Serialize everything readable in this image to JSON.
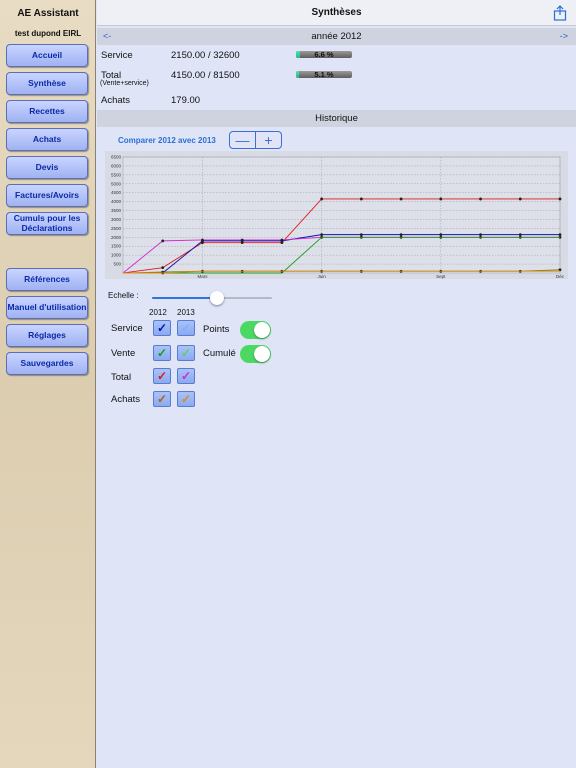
{
  "sidebar": {
    "app_title": "AE Assistant",
    "company": "test dupond EIRL",
    "buttons": [
      "Accueil",
      "Synthèse",
      "Recettes",
      "Achats",
      "Devis",
      "Factures/Avoirs",
      "Cumuls pour les Déclarations"
    ],
    "buttons2": [
      "Références",
      "Manuel d'utilisation",
      "Réglages",
      "Sauvegardes"
    ]
  },
  "header": {
    "title": "Synthèses",
    "share_icon": "share-icon"
  },
  "year_nav": {
    "prev": "<-",
    "label": "année 2012",
    "next": "->"
  },
  "summary": {
    "service": {
      "label": "Service",
      "value": "2150.00 / 32600",
      "percent_text": "6.6 %",
      "fraction": 0.066
    },
    "total": {
      "label": "Total",
      "sublabel": "(Vente+service)",
      "value": "4150.00 / 81500",
      "percent_text": "5.1 %",
      "fraction": 0.051
    },
    "achats": {
      "label": "Achats",
      "value": "179.00"
    }
  },
  "historique": {
    "title": "Historique",
    "compare_label": "Comparer 2012 avec 2013",
    "minus": "—",
    "plus": "+"
  },
  "chart_data": {
    "type": "line",
    "y_ticks": [
      "6500",
      "6000",
      "5500",
      "5000",
      "4500",
      "4000",
      "3500",
      "3000",
      "2500",
      "2000",
      "1500",
      "1000",
      "500"
    ],
    "ylim": [
      0,
      6500
    ],
    "x_ticks": [
      {
        "label": "Mars",
        "month": 3
      },
      {
        "label": "Juin",
        "month": 6
      },
      {
        "label": "Sept",
        "month": 9
      },
      {
        "label": "Déc",
        "month": 12
      }
    ],
    "months": [
      1,
      2,
      3,
      4,
      5,
      6,
      7,
      8,
      9,
      10,
      11,
      12
    ],
    "grid": true,
    "series": [
      {
        "color": "#e01a1a",
        "points": true,
        "values": [
          0,
          300,
          1700,
          1700,
          1700,
          4150,
          4150,
          4150,
          4150,
          4150,
          4150,
          4150
        ]
      },
      {
        "color": "#1010b0",
        "points": true,
        "values": [
          0,
          0,
          1800,
          1800,
          1800,
          2150,
          2150,
          2150,
          2150,
          2150,
          2150,
          2150
        ]
      },
      {
        "color": "#d22ad2",
        "points": true,
        "values": [
          0,
          1800,
          1850,
          1850,
          1850,
          2000,
          2000,
          2000,
          2000,
          2000,
          2000,
          2000
        ]
      },
      {
        "color": "#1c9a1c",
        "points": false,
        "values": [
          0,
          0,
          0,
          0,
          0,
          2000,
          2000,
          2000,
          2000,
          2000,
          2000,
          2000
        ]
      },
      {
        "color": "#7a7a00",
        "points": true,
        "values": [
          0,
          50,
          100,
          100,
          100,
          100,
          100,
          100,
          100,
          100,
          100,
          179
        ]
      },
      {
        "color": "#e08a1a",
        "points": false,
        "values": [
          0,
          0,
          100,
          100,
          100,
          100,
          100,
          100,
          100,
          100,
          100,
          100
        ]
      }
    ]
  },
  "controls": {
    "echelle_label": "Echelle :",
    "echelle_value": 0.55,
    "col_2012": "2012",
    "col_2013": "2013",
    "rows": [
      {
        "label": "Service",
        "color2012": "#1010b0",
        "color2013": "#7ab0ff"
      },
      {
        "label": "Vente",
        "color2012": "#1c9a1c",
        "color2013": "#5ed05e"
      },
      {
        "label": "Total",
        "color2012": "#e01a1a",
        "color2013": "#d22ad2"
      },
      {
        "label": "Achats",
        "color2012": "#b06010",
        "color2013": "#e08a1a"
      }
    ],
    "check_mark": "✓",
    "points_label": "Points",
    "cumule_label": "Cumulé",
    "toggle_color": "#4bd964"
  }
}
